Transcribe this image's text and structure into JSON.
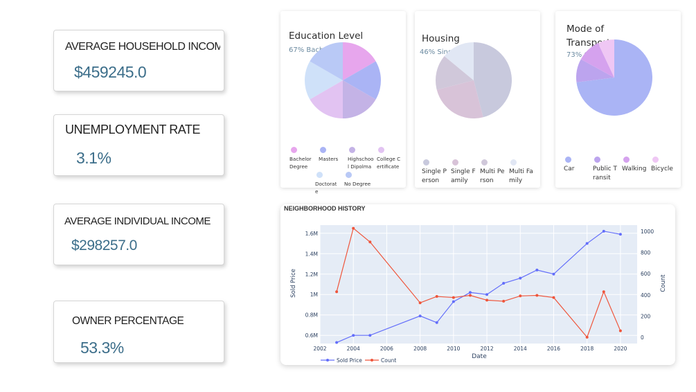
{
  "kpis": [
    {
      "title": "AVERAGE HOUSEHOLD INCOME",
      "value": "$459245.0"
    },
    {
      "title": "UNEMPLOYMENT RATE",
      "value": "3.1%"
    },
    {
      "title": "AVERAGE INDIVIDUAL INCOME",
      "value": "$298257.0"
    },
    {
      "title": "OWNER PERCENTAGE",
      "value": "53.3%"
    }
  ],
  "chart_data": [
    {
      "type": "pie",
      "title": "Education Level",
      "subtitle": "67% Bachelor Degree",
      "labels": [
        "Bachelor Degree",
        "Masters",
        "Highschool Dipolma",
        "College Certificate",
        "Doctorate",
        "No Degree"
      ],
      "values": [
        1,
        1,
        1,
        1,
        1,
        1
      ],
      "colors": [
        "#e7a6ed",
        "#aab4f5",
        "#c4b3e6",
        "#e2c3f2",
        "#cfe1f9",
        "#b9c9f6"
      ]
    },
    {
      "type": "pie",
      "title": "Housing",
      "subtitle": "46% Single Person",
      "labels": [
        "Single Person",
        "Single Family",
        "Multi Person",
        "Multi Family"
      ],
      "values": [
        46,
        25,
        15,
        14
      ],
      "colors": [
        "#c8c9dd",
        "#d8c3d8",
        "#d0c8da",
        "#e1e7f4"
      ]
    },
    {
      "type": "pie",
      "title": "Mode of Transport",
      "subtitle": "73% Car",
      "labels": [
        "Car",
        "Public Transit",
        "Walking",
        "Bicycle"
      ],
      "values": [
        73,
        10,
        10,
        7
      ],
      "colors": [
        "#aab4f5",
        "#bca4ee",
        "#d5a2ee",
        "#efc7f4"
      ]
    },
    {
      "type": "line",
      "title": "NEIGHBORHOOD HISTORY",
      "xlabel": "Date",
      "ylabel": "Sold Price",
      "y2label": "Count",
      "xlim": [
        2002,
        2021
      ],
      "xticks": [
        "2002",
        "2004",
        "2006",
        "2008",
        "2010",
        "2012",
        "2014",
        "2016",
        "2018",
        "2020"
      ],
      "yticks": [
        "1.6M",
        "1.4M",
        "1.2M",
        "1M",
        "0.8M",
        "0.6M"
      ],
      "ylim": [
        520000,
        1680000
      ],
      "y2ticks": [
        "1000",
        "800",
        "600",
        "400",
        "200",
        "0"
      ],
      "y2lim": [
        -60,
        1060
      ],
      "series": [
        {
          "name": "Sold Price",
          "axis": "y",
          "color": "#636efa",
          "x": [
            2003,
            2004,
            2005,
            2008,
            2009,
            2010,
            2011,
            2012,
            2013,
            2014,
            2015,
            2016,
            2018,
            2019,
            2020
          ],
          "y": [
            530000,
            600000,
            600000,
            790000,
            725000,
            930000,
            1020000,
            1000000,
            1110000,
            1160000,
            1240000,
            1200000,
            1500000,
            1620000,
            1590000
          ]
        },
        {
          "name": "Count",
          "axis": "y2",
          "color": "#ef553b",
          "x": [
            2003,
            2004,
            2005,
            2008,
            2009,
            2010,
            2011,
            2012,
            2013,
            2014,
            2015,
            2016,
            2018,
            2019,
            2020
          ],
          "y": [
            430,
            1030,
            900,
            325,
            385,
            375,
            395,
            350,
            340,
            390,
            395,
            375,
            0,
            430,
            60
          ]
        }
      ]
    }
  ]
}
